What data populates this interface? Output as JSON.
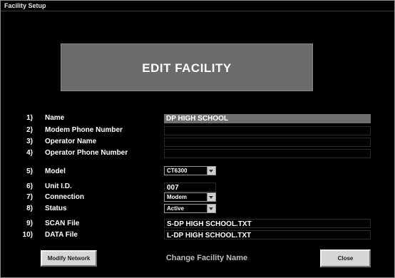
{
  "window": {
    "title": "Facility Setup"
  },
  "banner": {
    "text": "EDIT FACILITY"
  },
  "fields": [
    {
      "num": "1)",
      "label": "Name",
      "value": "DP HIGH SCHOOL"
    },
    {
      "num": "2)",
      "label": "Modem Phone Number",
      "value": ""
    },
    {
      "num": "3)",
      "label": "Operator Name",
      "value": ""
    },
    {
      "num": "4)",
      "label": "Operator Phone Number",
      "value": ""
    },
    {
      "num": "5)",
      "label": "Model",
      "value": "CT6300"
    },
    {
      "num": "6)",
      "label": "Unit I.D.",
      "value": "007"
    },
    {
      "num": "7)",
      "label": "Connection",
      "value": "Modem"
    },
    {
      "num": "8)",
      "label": "Status",
      "value": "Active"
    },
    {
      "num": "9)",
      "label": "SCAN File",
      "value": "S-DP HIGH SCHOOL.TXT"
    },
    {
      "num": "10)",
      "label": "DATA File",
      "value": "L-DP HIGH SCHOOL.TXT"
    }
  ],
  "buttons": {
    "modify_network": "Modify Network",
    "change_name": "Change Facility Name",
    "close": "Close"
  },
  "colors": {
    "background": "#000000",
    "banner": "#6b6b6b",
    "name_field": "#6f6f6f",
    "button": "#d6d6d6"
  }
}
